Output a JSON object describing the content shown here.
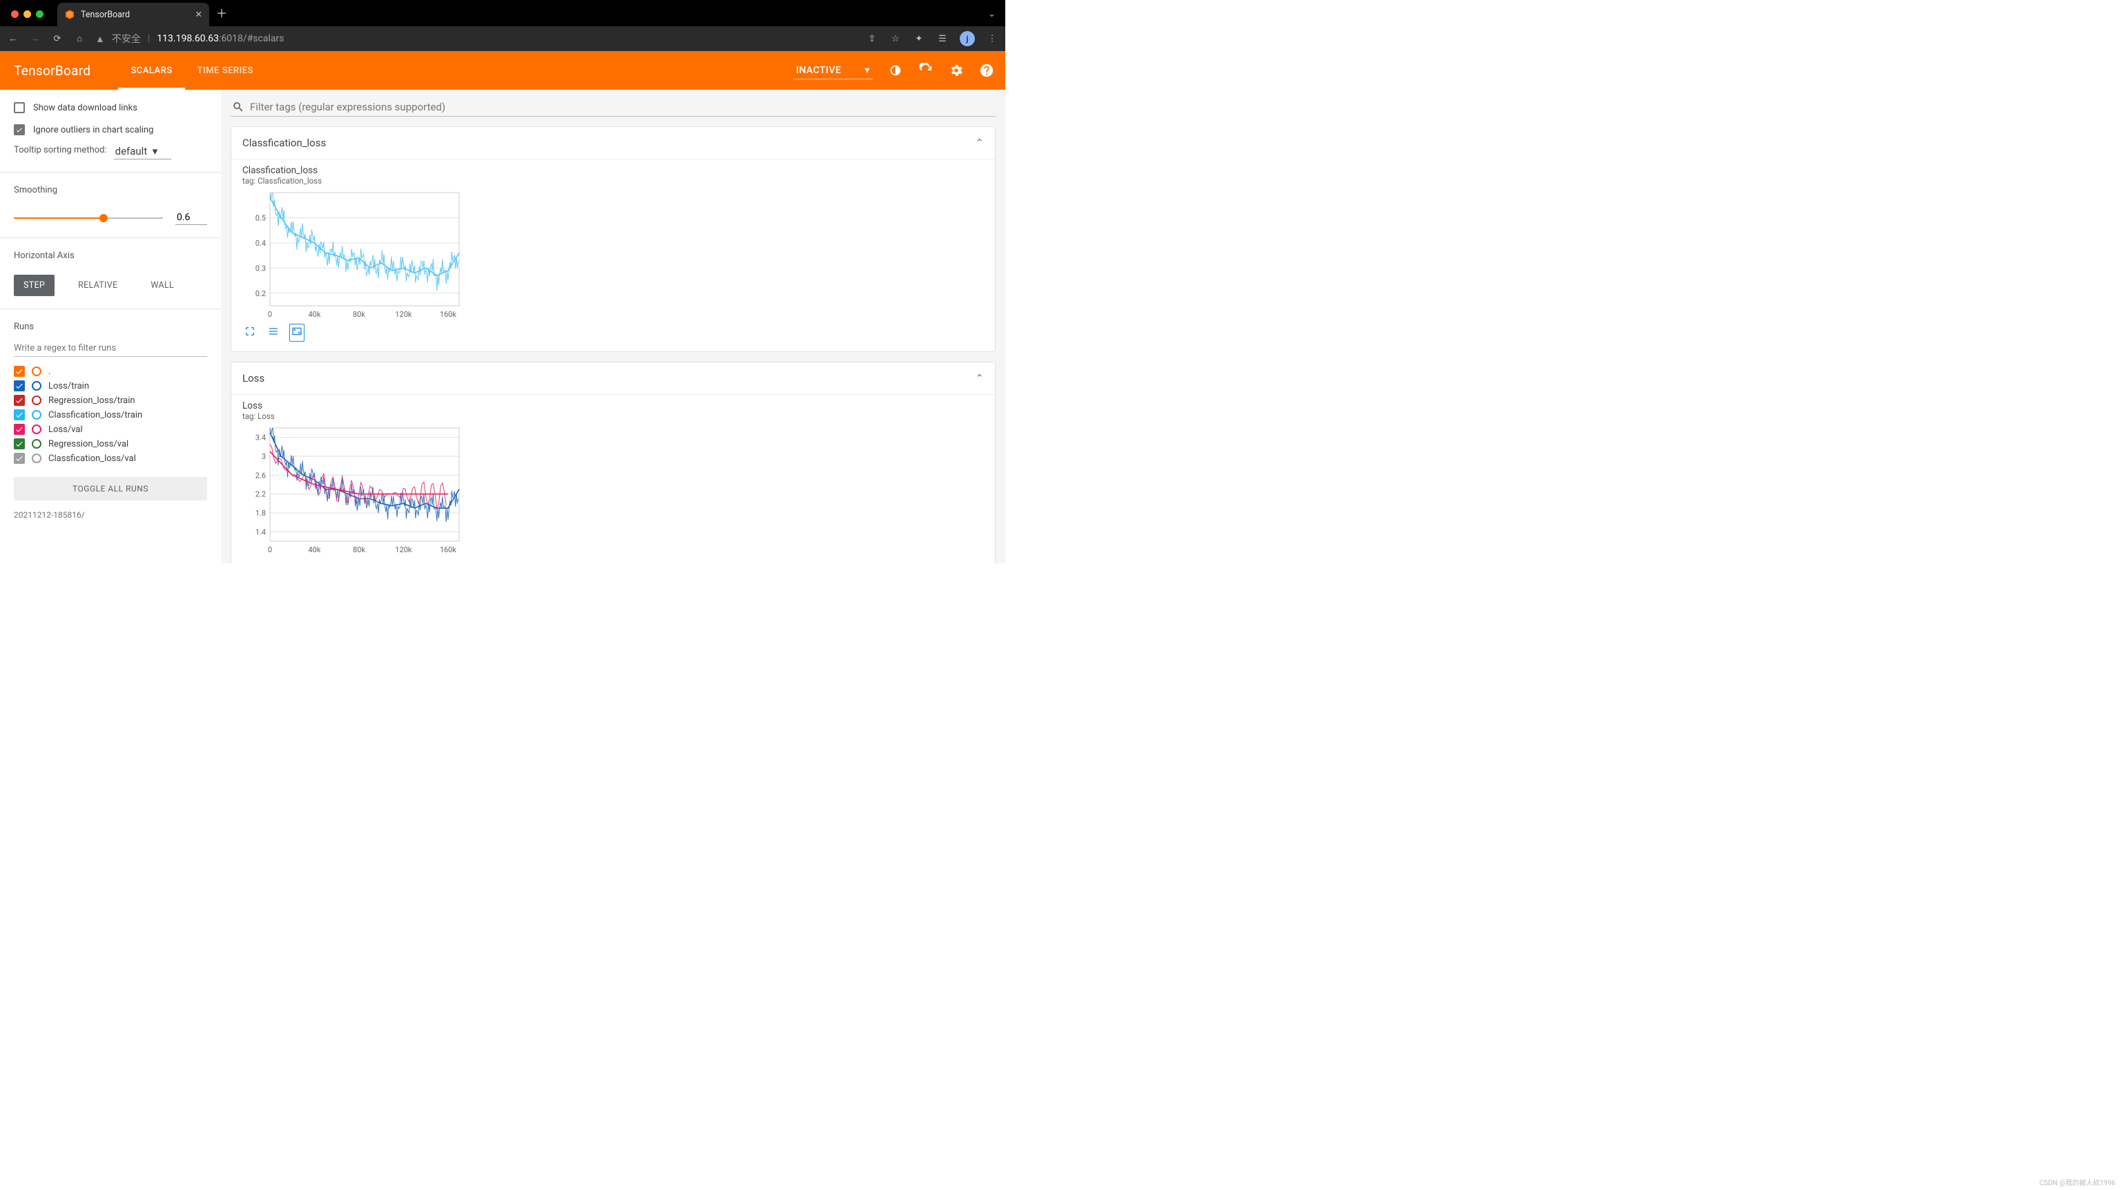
{
  "browser": {
    "tab_title": "TensorBoard",
    "url_warning": "不安全",
    "url_host": "113.198.60.63",
    "url_port": ":6018",
    "url_path": "/#scalars",
    "avatar_letter": "j"
  },
  "header": {
    "title": "TensorBoard",
    "tabs": [
      "SCALARS",
      "TIME SERIES"
    ],
    "active": "SCALARS",
    "selector": "INACTIVE"
  },
  "sidebar": {
    "show_download": {
      "label": "Show data download links",
      "checked": false
    },
    "ignore_outliers": {
      "label": "Ignore outliers in chart scaling",
      "checked": true
    },
    "tooltip_label": "Tooltip sorting method:",
    "tooltip_value": "default",
    "smoothing_label": "Smoothing",
    "smoothing_value": "0.6",
    "haxis_label": "Horizontal Axis",
    "haxis_options": [
      "STEP",
      "RELATIVE",
      "WALL"
    ],
    "haxis_active": "STEP",
    "runs_label": "Runs",
    "runs_filter_placeholder": "Write a regex to filter runs",
    "runs": [
      {
        "label": ".",
        "checked": true,
        "color": "#ff6f00"
      },
      {
        "label": "Loss/train",
        "checked": true,
        "color": "#1565c0"
      },
      {
        "label": "Regression_loss/train",
        "checked": true,
        "color": "#c62828"
      },
      {
        "label": "Classfication_loss/train",
        "checked": true,
        "color": "#29b6f6"
      },
      {
        "label": "Loss/val",
        "checked": true,
        "color": "#e91e63"
      },
      {
        "label": "Regression_loss/val",
        "checked": true,
        "color": "#2e7d32"
      },
      {
        "label": "Classfication_loss/val",
        "checked": true,
        "color": "#9e9e9e"
      }
    ],
    "toggle_all": "TOGGLE ALL RUNS",
    "timestamp": "20211212-185816/"
  },
  "main": {
    "filter_placeholder": "Filter tags (regular expressions supported)",
    "cards": [
      {
        "title": "Classfication_loss",
        "chart_title": "Classfication_loss",
        "chart_tag": "tag: Classfication_loss"
      },
      {
        "title": "Loss",
        "chart_title": "Loss",
        "chart_tag": "tag: Loss"
      }
    ]
  },
  "chart_data": [
    {
      "type": "line",
      "title": "Classfication_loss",
      "xlabel": "step",
      "ylabel": "",
      "xlim": [
        0,
        170000
      ],
      "ylim": [
        0.15,
        0.6
      ],
      "x_ticks": [
        "0",
        "40k",
        "80k",
        "120k",
        "160k"
      ],
      "y_ticks": [
        0.2,
        0.3,
        0.4,
        0.5
      ],
      "series": [
        {
          "name": "Classfication_loss/train",
          "color": "#4fc3f7",
          "x": [
            0,
            10000,
            20000,
            30000,
            40000,
            50000,
            60000,
            70000,
            80000,
            90000,
            100000,
            110000,
            120000,
            130000,
            140000,
            150000,
            160000,
            170000
          ],
          "values": [
            0.58,
            0.5,
            0.44,
            0.42,
            0.4,
            0.36,
            0.35,
            0.33,
            0.34,
            0.3,
            0.32,
            0.29,
            0.3,
            0.28,
            0.3,
            0.27,
            0.29,
            0.36
          ]
        }
      ]
    },
    {
      "type": "line",
      "title": "Loss",
      "xlabel": "step",
      "ylabel": "",
      "xlim": [
        0,
        170000
      ],
      "ylim": [
        1.2,
        3.6
      ],
      "x_ticks": [
        "0",
        "40k",
        "80k",
        "120k",
        "160k"
      ],
      "y_ticks": [
        1.4,
        1.8,
        2.2,
        2.6,
        3.0,
        3.4
      ],
      "series": [
        {
          "name": "Loss/train",
          "color": "#1e66b8",
          "x": [
            0,
            10000,
            20000,
            30000,
            40000,
            50000,
            60000,
            70000,
            80000,
            90000,
            100000,
            110000,
            120000,
            130000,
            140000,
            150000,
            160000,
            170000
          ],
          "values": [
            3.5,
            3.0,
            2.8,
            2.6,
            2.5,
            2.3,
            2.3,
            2.2,
            2.1,
            2.1,
            2.0,
            1.95,
            2.0,
            1.9,
            2.0,
            1.9,
            1.9,
            2.3
          ]
        },
        {
          "name": "Loss/val",
          "color": "#e91e63",
          "x": [
            0,
            20000,
            40000,
            60000,
            80000,
            100000,
            120000,
            140000,
            160000
          ],
          "values": [
            3.1,
            2.6,
            2.4,
            2.3,
            2.2,
            2.2,
            2.2,
            2.2,
            2.2
          ]
        }
      ]
    }
  ],
  "watermark": "CSDN @我的被人砍1996"
}
